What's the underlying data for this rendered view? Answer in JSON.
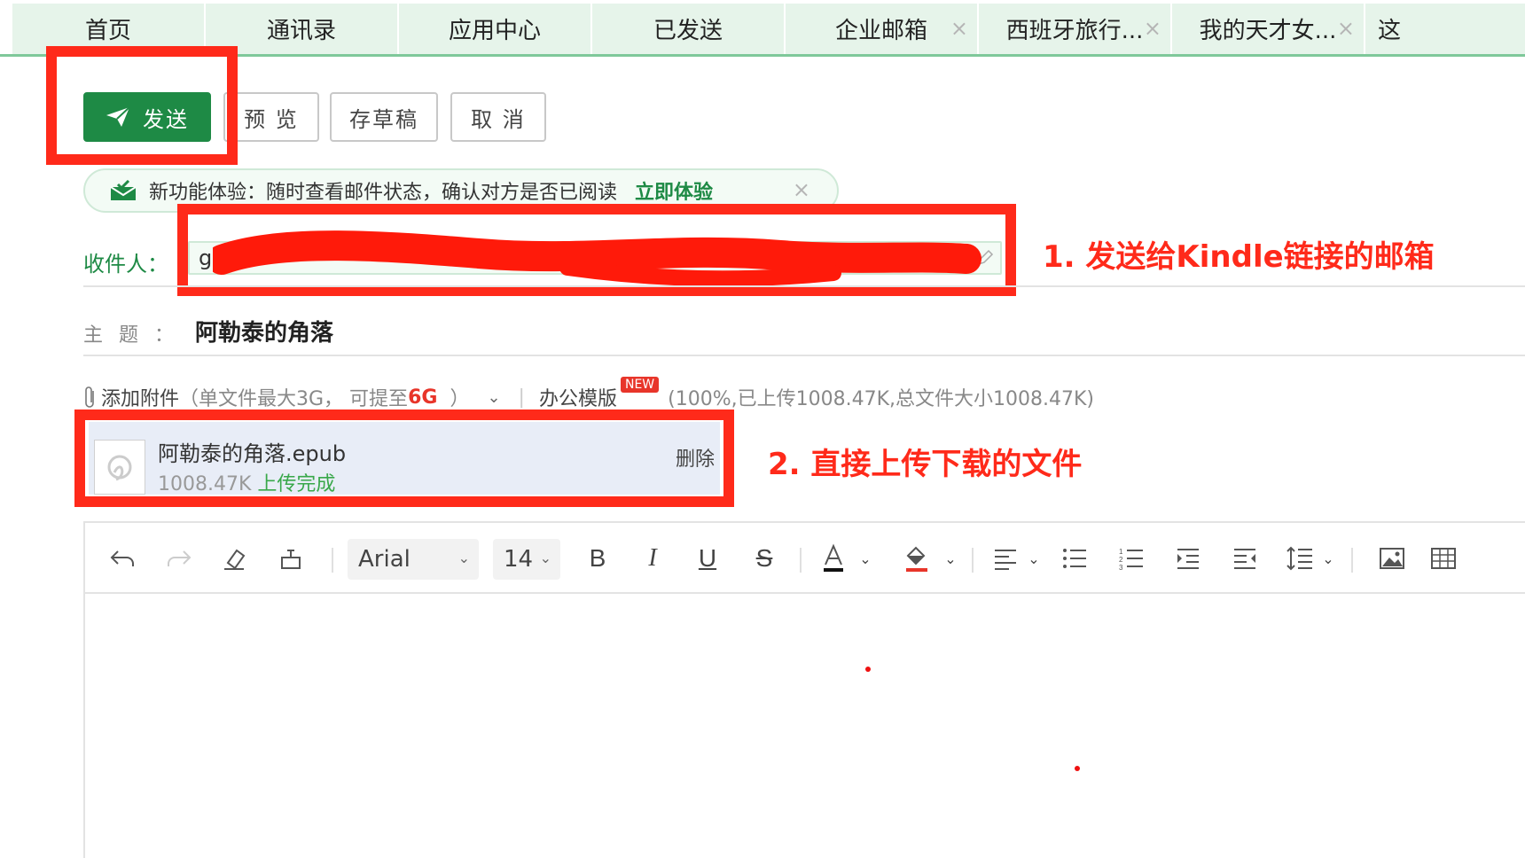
{
  "tabs": [
    {
      "label": "首页",
      "closable": false
    },
    {
      "label": "通讯录",
      "closable": false
    },
    {
      "label": "应用中心",
      "closable": false
    },
    {
      "label": "已发送",
      "closable": false
    },
    {
      "label": "企业邮箱",
      "closable": true
    },
    {
      "label": "西班牙旅行...",
      "closable": true
    },
    {
      "label": "我的天才女...",
      "closable": true
    },
    {
      "label": "这",
      "closable": false
    }
  ],
  "toolbar": {
    "send_label": "发送",
    "preview_label": "预 览",
    "draft_label": "存草稿",
    "cancel_label": "取 消"
  },
  "banner": {
    "text": "新功能体验：随时查看邮件状态，确认对方是否已阅读",
    "link": "立即体验",
    "close": "×"
  },
  "recipient": {
    "label": "收件人：",
    "value": "gi"
  },
  "subject": {
    "label": "主题：",
    "value": "阿勒泰的角落"
  },
  "attachment_bar": {
    "add_label": "添加附件",
    "limit_text": "（单文件最大3G，  可提至",
    "limit_highlight": "6G",
    "limit_close": "）",
    "office_template": "办公模版",
    "new_badge": "NEW",
    "progress": "(100%,已上传1008.47K,总文件大小1008.47K)"
  },
  "attachment": {
    "filename": "阿勒泰的角落.epub",
    "size": "1008.47K",
    "status": "上传完成",
    "delete": "删除"
  },
  "annotations": {
    "step1": "1. 发送给Kindle链接的邮箱",
    "step2": "2. 直接上传下载的文件"
  },
  "editor": {
    "font": "Arial",
    "font_size": "14"
  },
  "colors": {
    "brand_green": "#1e8a45",
    "tab_bg": "#e6f4ea",
    "annotation_red": "#ff2a1a"
  }
}
